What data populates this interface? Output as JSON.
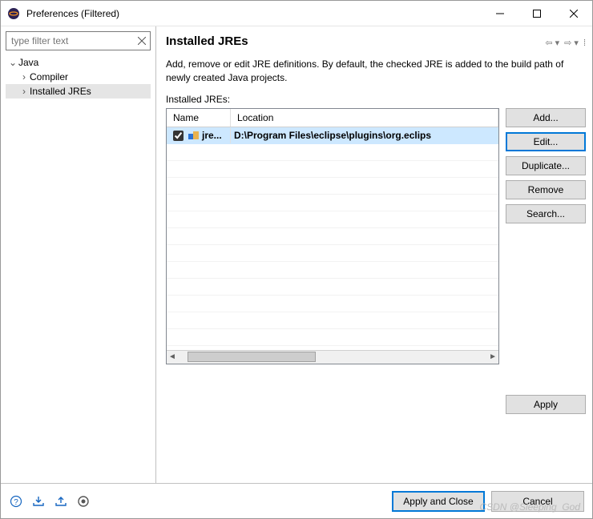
{
  "window": {
    "title": "Preferences (Filtered)"
  },
  "filter": {
    "placeholder": "type filter text"
  },
  "tree": {
    "root": "Java",
    "children": [
      "Compiler",
      "Installed JREs"
    ],
    "selected": "Installed JREs"
  },
  "page": {
    "heading": "Installed JREs",
    "description": "Add, remove or edit JRE definitions. By default, the checked JRE is added to the build path of newly created Java projects.",
    "table_label": "Installed JREs:"
  },
  "table": {
    "columns": {
      "name": "Name",
      "location": "Location"
    },
    "rows": [
      {
        "checked": true,
        "name": "jre...",
        "location": "D:\\Program Files\\eclipse\\plugins\\org.eclips"
      }
    ]
  },
  "side_buttons": {
    "add": "Add...",
    "edit": "Edit...",
    "duplicate": "Duplicate...",
    "remove": "Remove",
    "search": "Search..."
  },
  "apply": "Apply",
  "dialog_buttons": {
    "apply_close": "Apply and Close",
    "cancel": "Cancel"
  },
  "watermark": "CSDN @Sleeping_God"
}
